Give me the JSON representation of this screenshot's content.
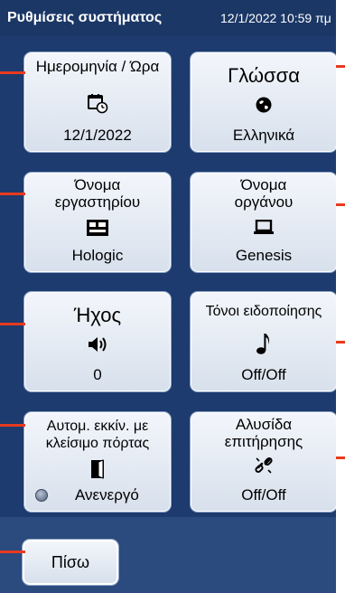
{
  "header": {
    "title": "Ρυθμίσεις συστήματος",
    "datetime": "12/1/2022 10:59 πμ"
  },
  "tiles": {
    "date_time": {
      "label": "Ημερομηνία / Ώρα",
      "value": "12/1/2022",
      "icon": "calendar-clock-icon"
    },
    "language": {
      "label": "Γλώσσα",
      "value": "Ελληνικά",
      "icon": "globe-icon"
    },
    "lab_name": {
      "label_line1": "Όνομα",
      "label_line2": "εργαστηρίου",
      "value": "Hologic",
      "icon": "lab-building-icon"
    },
    "instrument_name": {
      "label_line1": "Όνομα",
      "label_line2": "οργάνου",
      "value": "Genesis",
      "icon": "laptop-icon"
    },
    "sound": {
      "label": "Ήχος",
      "value": "0",
      "icon": "speaker-icon"
    },
    "notification_tones": {
      "label": "Τόνοι ειδοποίησης",
      "value": "Off/Off",
      "icon": "music-note-icon"
    },
    "auto_start": {
      "label_line1": "Αυτομ. εκκίν. με",
      "label_line2": "κλείσιμο πόρτας",
      "value": "Ανενεργό",
      "icon": "door-icon"
    },
    "watch_chain": {
      "label_line1": "Αλυσίδα",
      "label_line2": "επιτήρησης",
      "value": "Off/Off",
      "icon": "broken-chain-icon"
    }
  },
  "footer": {
    "back_label": "Πίσω"
  },
  "colors": {
    "panel_bg": "#1d3b6e",
    "marker": "#e83a1f",
    "tile_border": "#8ea5c7"
  }
}
